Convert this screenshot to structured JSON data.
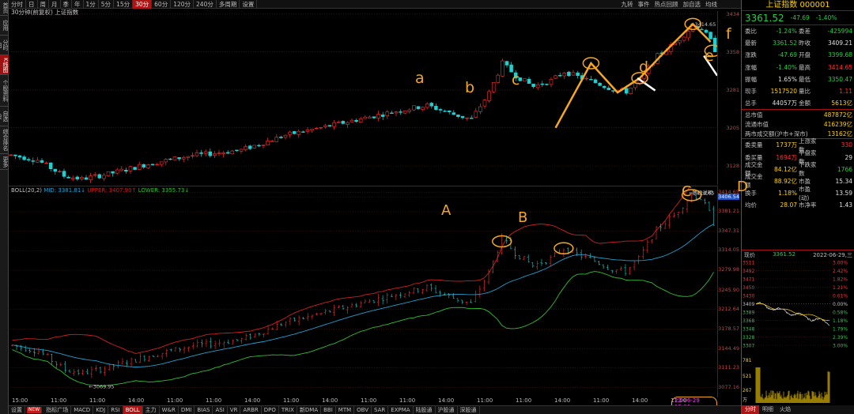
{
  "left_nav": [
    "首页",
    "应用",
    "分时图",
    "K线图",
    "个股资料",
    "自选股",
    "综合排名",
    "更多"
  ],
  "left_nav_active": 3,
  "top_timeframes": [
    "分时",
    "日",
    "周",
    "月",
    "季",
    "年",
    "1分",
    "5分",
    "15分",
    "30分",
    "60分",
    "120分",
    "240分",
    "多周期",
    "设置"
  ],
  "top_timeframe_active": 9,
  "top_right": [
    "九转",
    "事件",
    "热点回顾",
    "加自选",
    "均线"
  ],
  "subtitle": "30分钟(前复权)  上证指数",
  "boll_label": {
    "prefix": "BOLL(20,2)",
    "mid": "MID: 3381.81↓",
    "upper": "UPPER: 3407.90↑",
    "lower": "LOWER: 3355.73↓"
  },
  "main_yticks": [
    "3434",
    "3358",
    "3281",
    "3205",
    "3128"
  ],
  "boll_yticks": [
    "3414.65",
    "3406.54",
    "3381.21",
    "3347.31",
    "3314.05",
    "3279.98",
    "3245.90",
    "3212.64",
    "3178.57",
    "3144.49",
    "3111.23",
    "3077.16"
  ],
  "main_annotations": {
    "high": "3414.65",
    "low": "3069.95"
  },
  "boll_annotations": {
    "high": "3414.65",
    "low": "3069.95",
    "note": "阶段说明"
  },
  "letters_lower": [
    "a",
    "b",
    "c",
    "d",
    "e",
    "f"
  ],
  "letters_upper": [
    "A",
    "B",
    "C",
    "D"
  ],
  "xaxis": [
    "15:00",
    "11:00",
    "11:00",
    "14:00",
    "11:00",
    "11:00",
    "14:00",
    "11:00",
    "14:00",
    "11:00",
    "11:00",
    "14:00",
    "11:00",
    "11:00",
    "14:00",
    "11:00",
    "14:00",
    "11:00"
  ],
  "xaxis_highlight": "22-06-29 15:00",
  "bottom_tabs": [
    "设置",
    "NEW",
    "指标广场",
    "MACD",
    "KDJ",
    "RSI",
    "BOLL",
    "主力",
    "W&R",
    "DMI",
    "BIAS",
    "ASI",
    "VR",
    "ARBR",
    "DPO",
    "TRIX",
    "新DMA",
    "BBI",
    "MTM",
    "OBV",
    "SAR",
    "EXPMA",
    "陆股通",
    "沪股通",
    "深股通"
  ],
  "bottom_tab_active": "BOLL",
  "right_panel": {
    "title": "上证指数 000001",
    "price": "3361.52",
    "change": "-47.69",
    "change_pct": "-1.40%",
    "rows": [
      {
        "c1": "委比",
        "c2": "-1.24%",
        "c3": "委差",
        "c4": "-425994",
        "cls2": "grn",
        "cls4": "grn"
      },
      {
        "c1": "最新",
        "c2": "3361.52",
        "c3": "昨收",
        "c4": "3409.21",
        "cls2": "grn",
        "cls4": "wht"
      },
      {
        "c1": "涨跌",
        "c2": "-47.69",
        "c3": "开盘",
        "c4": "3399.68",
        "cls2": "grn",
        "cls4": "grn"
      },
      {
        "c1": "涨幅",
        "c2": "-1.40%",
        "c3": "最高",
        "c4": "3414.65",
        "cls2": "grn",
        "cls4": "red"
      },
      {
        "c1": "振幅",
        "c2": "1.65%",
        "c3": "最低",
        "c4": "3350.47",
        "cls2": "wht",
        "cls4": "grn"
      },
      {
        "c1": "现手",
        "c2": "1517520",
        "c3": "量比",
        "c4": "1.11",
        "cls2": "yel",
        "cls4": "red"
      },
      {
        "c1": "总手",
        "c2": "44057万",
        "c3": "金额",
        "c4": "5613亿",
        "cls2": "wht",
        "cls4": "yel"
      }
    ],
    "rows2": [
      {
        "label": "总市值",
        "value": "487872亿"
      },
      {
        "label": "流通市值",
        "value": "416239亿"
      },
      {
        "label": "两市成交额(沪市+深市)",
        "value": "13162亿"
      }
    ],
    "rows3": [
      {
        "c1": "委卖量",
        "c2": "1737万",
        "c3": "上涨家数",
        "c4": "330",
        "cls2": "yel",
        "cls4": "red"
      },
      {
        "c1": "委买量",
        "c2": "1694万",
        "c3": "平盘家数",
        "c4": "29",
        "cls2": "red",
        "cls4": "wht"
      },
      {
        "c1": "成交金额",
        "c2": "84.12亿",
        "c3": "下跌家数",
        "c4": "1766",
        "cls2": "yel",
        "cls4": "grn"
      },
      {
        "c1": "成交金额",
        "c2": "88.92亿",
        "c3": "市盈",
        "c4": "15.34",
        "cls2": "yel",
        "cls4": "wht"
      },
      {
        "c1": "换手",
        "c2": "1.18%",
        "c3": "市盈(动)",
        "c4": "13.59",
        "cls2": "yel",
        "cls4": "wht"
      },
      {
        "c1": "均价",
        "c2": "28.07",
        "c3": "市净率",
        "c4": "1.43",
        "cls2": "yel",
        "cls4": "wht"
      }
    ],
    "mini": {
      "label": "现价",
      "price": "3361.52",
      "date": "2022-06-29,三",
      "left_ticks": [
        "3511",
        "3492",
        "3471",
        "3450",
        "3430",
        "3409",
        "3389",
        "3368",
        "3348",
        "3328",
        "3307",
        "781",
        "521",
        "267",
        "万"
      ],
      "right_ticks": [
        "3.00%",
        "2.42%",
        "1.82%",
        "1.21%",
        "0.61%",
        "0.00%",
        "0.58%",
        "1.18%",
        "1.79%",
        "2.39%",
        "3.00%"
      ]
    },
    "minitabs": [
      "分时",
      "明细",
      "火焰"
    ]
  },
  "colors": {
    "up": "#ff3030",
    "down": "#20d0d0",
    "annotation": "#f5a623",
    "mid_line": "#1fa0d0",
    "upper_line": "#d02020",
    "lower_line": "#30c030"
  }
}
